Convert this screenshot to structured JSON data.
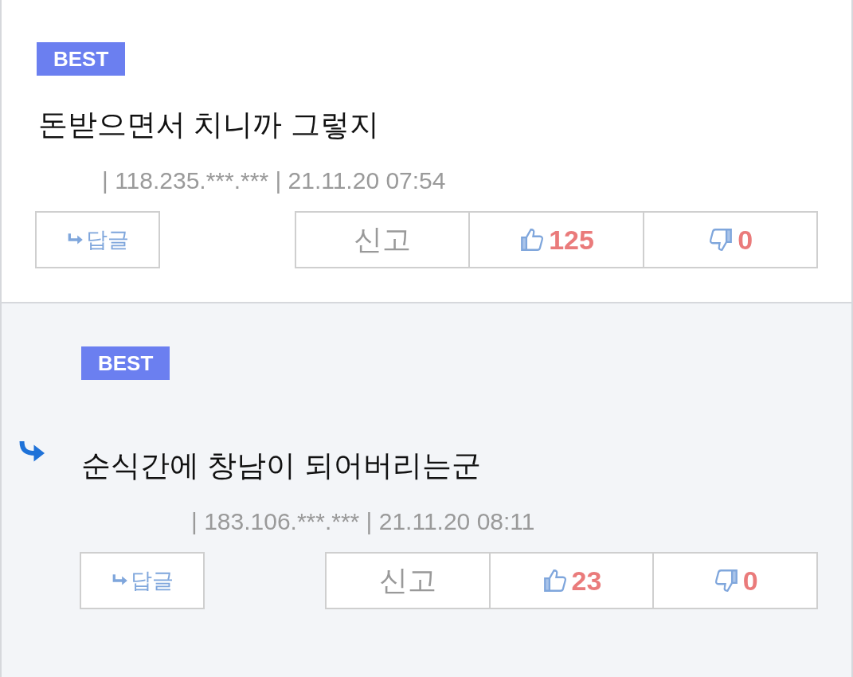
{
  "comments": [
    {
      "kind": "top",
      "badge": "BEST",
      "text": "돈받으면서 치니까 그렇지",
      "meta": "| 118.235.***.*** | 21.11.20 07:54",
      "reply_label": "답글",
      "report_label": "신고",
      "likes": "125",
      "dislikes": "0"
    },
    {
      "kind": "reply",
      "badge": "BEST",
      "text": "순식간에 창남이 되어버리는군",
      "meta": "| 183.106.***.*** | 21.11.20 08:11",
      "reply_label": "답글",
      "report_label": "신고",
      "likes": "23",
      "dislikes": "0"
    }
  ]
}
